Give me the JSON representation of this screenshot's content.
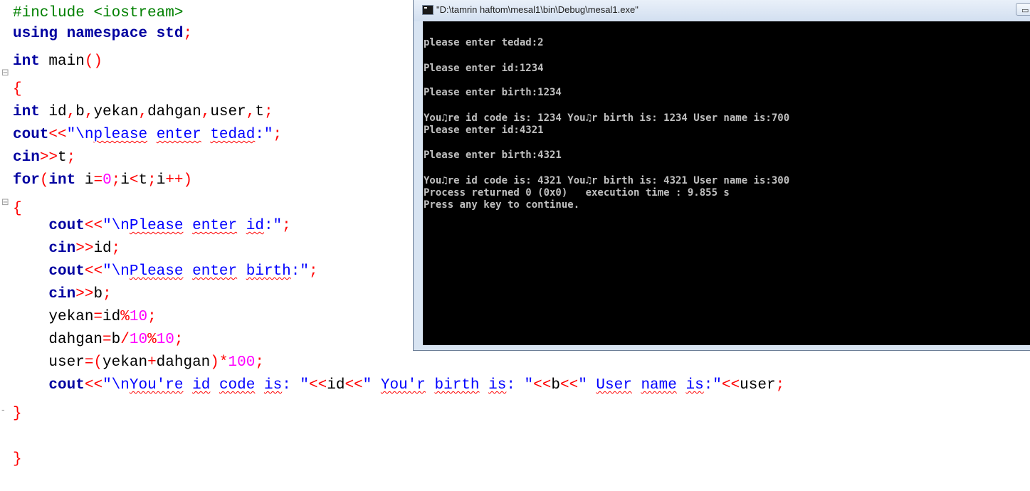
{
  "editor": {
    "lines": [
      [
        {
          "t": "#include <iostream>",
          "c": "t-pre"
        }
      ],
      [
        {
          "t": "using namespace ",
          "c": "t-kw"
        },
        {
          "t": "std",
          "c": "t-kw"
        },
        {
          "t": ";",
          "c": "t-op"
        }
      ],
      [
        {
          "t": "int",
          "c": "t-kw"
        },
        {
          "t": " main",
          "c": "t-plain"
        },
        {
          "t": "()",
          "c": "t-op"
        }
      ],
      [
        {
          "t": "{",
          "c": "t-op"
        }
      ],
      [
        {
          "t": "int",
          "c": "t-kw"
        },
        {
          "t": " id",
          "c": "t-plain"
        },
        {
          "t": ",",
          "c": "t-op"
        },
        {
          "t": "b",
          "c": "t-plain"
        },
        {
          "t": ",",
          "c": "t-op"
        },
        {
          "t": "yekan",
          "c": "t-plain"
        },
        {
          "t": ",",
          "c": "t-op"
        },
        {
          "t": "dahgan",
          "c": "t-plain"
        },
        {
          "t": ",",
          "c": "t-op"
        },
        {
          "t": "user",
          "c": "t-plain"
        },
        {
          "t": ",",
          "c": "t-op"
        },
        {
          "t": "t",
          "c": "t-plain"
        },
        {
          "t": ";",
          "c": "t-op"
        }
      ],
      [
        {
          "t": "cout",
          "c": "t-kw"
        },
        {
          "t": "<<",
          "c": "t-op"
        },
        {
          "t": "\"\\n",
          "c": "t-str"
        },
        {
          "t": "please",
          "c": "t-spell"
        },
        {
          "t": " ",
          "c": "t-str"
        },
        {
          "t": "enter",
          "c": "t-spell"
        },
        {
          "t": " ",
          "c": "t-str"
        },
        {
          "t": "tedad",
          "c": "t-spell"
        },
        {
          "t": ":\"",
          "c": "t-str"
        },
        {
          "t": ";",
          "c": "t-op"
        }
      ],
      [
        {
          "t": "cin",
          "c": "t-kw"
        },
        {
          "t": ">>",
          "c": "t-op"
        },
        {
          "t": "t",
          "c": "t-plain"
        },
        {
          "t": ";",
          "c": "t-op"
        }
      ],
      [
        {
          "t": "for",
          "c": "t-kw"
        },
        {
          "t": "(",
          "c": "t-op"
        },
        {
          "t": "int",
          "c": "t-kw"
        },
        {
          "t": " i",
          "c": "t-plain"
        },
        {
          "t": "=",
          "c": "t-op"
        },
        {
          "t": "0",
          "c": "t-num"
        },
        {
          "t": ";",
          "c": "t-op"
        },
        {
          "t": "i",
          "c": "t-plain"
        },
        {
          "t": "<",
          "c": "t-op"
        },
        {
          "t": "t",
          "c": "t-plain"
        },
        {
          "t": ";",
          "c": "t-op"
        },
        {
          "t": "i",
          "c": "t-plain"
        },
        {
          "t": "++)",
          "c": "t-op"
        }
      ],
      [
        {
          "t": "{",
          "c": "t-op"
        }
      ],
      [
        {
          "t": "    ",
          "c": "t-plain"
        },
        {
          "t": "cout",
          "c": "t-kw"
        },
        {
          "t": "<<",
          "c": "t-op"
        },
        {
          "t": "\"\\n",
          "c": "t-str"
        },
        {
          "t": "Please",
          "c": "t-spell"
        },
        {
          "t": " ",
          "c": "t-str"
        },
        {
          "t": "enter",
          "c": "t-spell"
        },
        {
          "t": " ",
          "c": "t-str"
        },
        {
          "t": "id",
          "c": "t-spell"
        },
        {
          "t": ":\"",
          "c": "t-str"
        },
        {
          "t": ";",
          "c": "t-op"
        }
      ],
      [
        {
          "t": "    ",
          "c": "t-plain"
        },
        {
          "t": "cin",
          "c": "t-kw"
        },
        {
          "t": ">>",
          "c": "t-op"
        },
        {
          "t": "id",
          "c": "t-plain"
        },
        {
          "t": ";",
          "c": "t-op"
        }
      ],
      [
        {
          "t": "    ",
          "c": "t-plain"
        },
        {
          "t": "cout",
          "c": "t-kw"
        },
        {
          "t": "<<",
          "c": "t-op"
        },
        {
          "t": "\"\\n",
          "c": "t-str"
        },
        {
          "t": "Please",
          "c": "t-spell"
        },
        {
          "t": " ",
          "c": "t-str"
        },
        {
          "t": "enter",
          "c": "t-spell"
        },
        {
          "t": " ",
          "c": "t-str"
        },
        {
          "t": "birth",
          "c": "t-spell"
        },
        {
          "t": ":\"",
          "c": "t-str"
        },
        {
          "t": ";",
          "c": "t-op"
        }
      ],
      [
        {
          "t": "    ",
          "c": "t-plain"
        },
        {
          "t": "cin",
          "c": "t-kw"
        },
        {
          "t": ">>",
          "c": "t-op"
        },
        {
          "t": "b",
          "c": "t-plain"
        },
        {
          "t": ";",
          "c": "t-op"
        }
      ],
      [
        {
          "t": "    yekan",
          "c": "t-plain"
        },
        {
          "t": "=",
          "c": "t-op"
        },
        {
          "t": "id",
          "c": "t-plain"
        },
        {
          "t": "%",
          "c": "t-op"
        },
        {
          "t": "10",
          "c": "t-num"
        },
        {
          "t": ";",
          "c": "t-op"
        }
      ],
      [
        {
          "t": "    dahgan",
          "c": "t-plain"
        },
        {
          "t": "=",
          "c": "t-op"
        },
        {
          "t": "b",
          "c": "t-plain"
        },
        {
          "t": "/",
          "c": "t-op"
        },
        {
          "t": "10",
          "c": "t-num"
        },
        {
          "t": "%",
          "c": "t-op"
        },
        {
          "t": "10",
          "c": "t-num"
        },
        {
          "t": ";",
          "c": "t-op"
        }
      ],
      [
        {
          "t": "    user",
          "c": "t-plain"
        },
        {
          "t": "=(",
          "c": "t-op"
        },
        {
          "t": "yekan",
          "c": "t-plain"
        },
        {
          "t": "+",
          "c": "t-op"
        },
        {
          "t": "dahgan",
          "c": "t-plain"
        },
        {
          "t": ")*",
          "c": "t-op"
        },
        {
          "t": "100",
          "c": "t-num"
        },
        {
          "t": ";",
          "c": "t-op"
        }
      ],
      [
        {
          "t": "    ",
          "c": "t-plain"
        },
        {
          "t": "cout",
          "c": "t-kw"
        },
        {
          "t": "<<",
          "c": "t-op"
        },
        {
          "t": "\"\\n",
          "c": "t-str"
        },
        {
          "t": "You're",
          "c": "t-spell"
        },
        {
          "t": " ",
          "c": "t-str"
        },
        {
          "t": "id",
          "c": "t-spell"
        },
        {
          "t": " ",
          "c": "t-str"
        },
        {
          "t": "code",
          "c": "t-spell"
        },
        {
          "t": " ",
          "c": "t-str"
        },
        {
          "t": "is",
          "c": "t-spell"
        },
        {
          "t": ": \"",
          "c": "t-str"
        },
        {
          "t": "<<",
          "c": "t-op"
        },
        {
          "t": "id",
          "c": "t-plain"
        },
        {
          "t": "<<",
          "c": "t-op"
        },
        {
          "t": "\" ",
          "c": "t-str"
        },
        {
          "t": "You'r",
          "c": "t-spell"
        },
        {
          "t": " ",
          "c": "t-str"
        },
        {
          "t": "birth",
          "c": "t-spell"
        },
        {
          "t": " ",
          "c": "t-str"
        },
        {
          "t": "is",
          "c": "t-spell"
        },
        {
          "t": ": \"",
          "c": "t-str"
        },
        {
          "t": "<<",
          "c": "t-op"
        },
        {
          "t": "b",
          "c": "t-plain"
        },
        {
          "t": "<<",
          "c": "t-op"
        },
        {
          "t": "\" ",
          "c": "t-str"
        },
        {
          "t": "User",
          "c": "t-spell"
        },
        {
          "t": " ",
          "c": "t-str"
        },
        {
          "t": "name",
          "c": "t-spell"
        },
        {
          "t": " ",
          "c": "t-str"
        },
        {
          "t": "is",
          "c": "t-spell"
        },
        {
          "t": ":\"",
          "c": "t-str"
        },
        {
          "t": "<<",
          "c": "t-op"
        },
        {
          "t": "user",
          "c": "t-plain"
        },
        {
          "t": ";",
          "c": "t-op"
        }
      ],
      [
        {
          "t": "}",
          "c": "t-op"
        }
      ],
      [
        {
          "t": "",
          "c": "t-plain"
        }
      ],
      [
        {
          "t": "}",
          "c": "t-op"
        }
      ]
    ],
    "fold_markers": [
      "⊟",
      "⊟",
      "-"
    ]
  },
  "console": {
    "title": "\"D:\\tamrin haftom\\mesal1\\bin\\Debug\\mesal1.exe\"",
    "minimize_glyph": "▭",
    "output": [
      "please enter tedad:2",
      "Please enter id:1234",
      "Please enter birth:1234",
      "You♫re id code is: 1234 You♫r birth is: 1234 User name is:700",
      "Please enter id:4321",
      "Please enter birth:4321",
      "You♫re id code is: 4321 You♫r birth is: 4321 User name is:300",
      "Process returned 0 (0x0)   execution time : 9.855 s",
      "Press any key to continue."
    ]
  }
}
